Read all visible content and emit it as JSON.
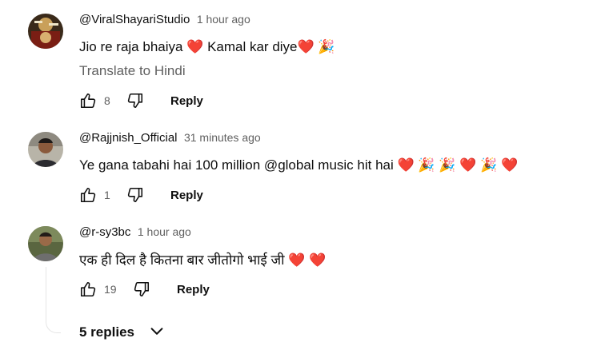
{
  "comments": [
    {
      "author": "@ViralShayariStudio",
      "time": "1 hour ago",
      "text": "Jio re raja bhaiya ❤️ Kamal kar diye❤️ 🎉",
      "translate": "Translate to Hindi",
      "likes": "8",
      "reply": "Reply"
    },
    {
      "author": "@Rajjnish_Official",
      "time": "31 minutes ago",
      "text": "Ye gana tabahi hai 100 million @global music hit hai ❤️ 🎉 🎉 ❤️ 🎉 ❤️",
      "likes": "1",
      "reply": "Reply"
    },
    {
      "author": "@r-sy3bc",
      "time": "1 hour ago",
      "text": "एक ही दिल है कितना बार जीतोगो भाई जी ❤️ ❤️",
      "likes": "19",
      "reply": "Reply"
    }
  ],
  "replies_toggle": "5 replies",
  "icons": {
    "like": "thumbs-up-icon",
    "dislike": "thumbs-down-icon",
    "expand": "chevron-down-icon"
  },
  "colors": {
    "text": "#0f0f0f",
    "secondary": "#606060",
    "heart": "#e0245e"
  }
}
